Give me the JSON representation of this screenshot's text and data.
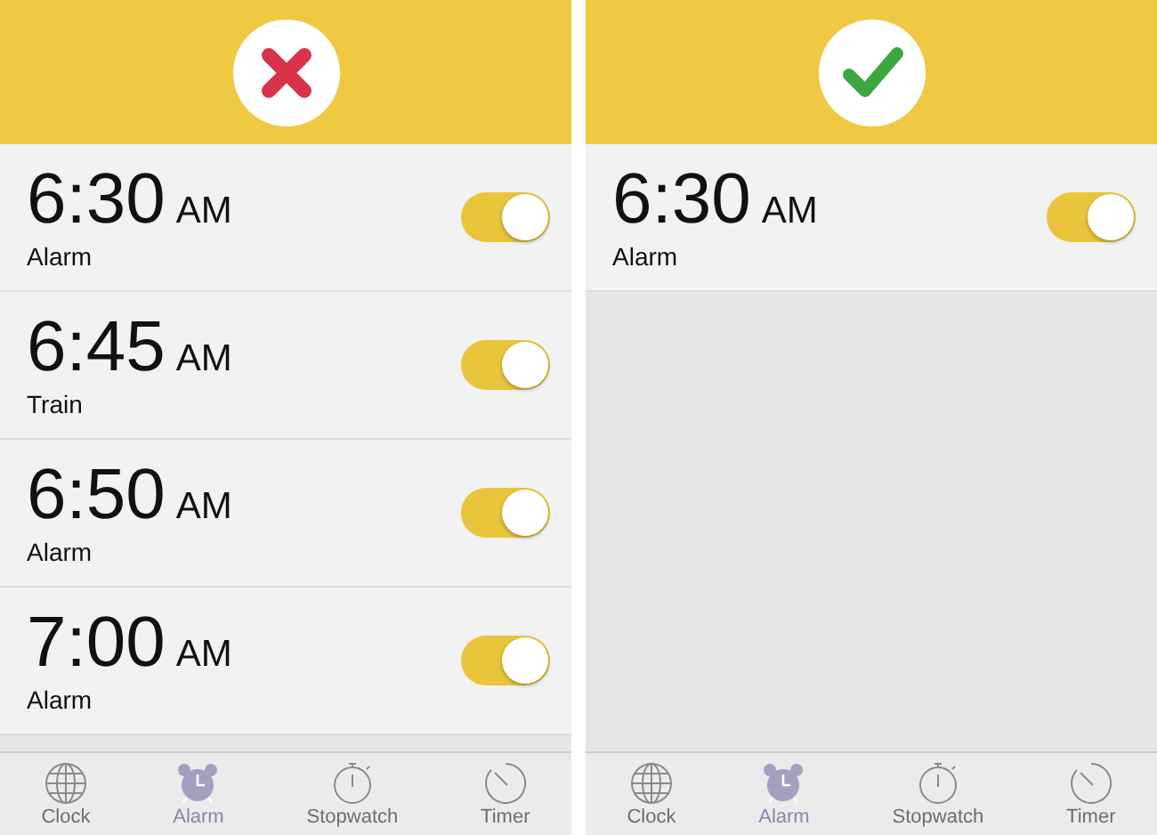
{
  "panels": [
    {
      "kind": "wrong",
      "alarms": [
        {
          "time": "6:30",
          "period": "AM",
          "label": "Alarm",
          "on": true
        },
        {
          "time": "6:45",
          "period": "AM",
          "label": "Train",
          "on": true
        },
        {
          "time": "6:50",
          "period": "AM",
          "label": "Alarm",
          "on": true
        },
        {
          "time": "7:00",
          "period": "AM",
          "label": "Alarm",
          "on": true
        }
      ],
      "tabs": [
        {
          "kind": "globe",
          "label": "Clock",
          "selected": false
        },
        {
          "kind": "alarm",
          "label": "Alarm",
          "selected": true
        },
        {
          "kind": "stopwatch",
          "label": "Stopwatch",
          "selected": false
        },
        {
          "kind": "timer",
          "label": "Timer",
          "selected": false
        }
      ]
    },
    {
      "kind": "right",
      "alarms": [
        {
          "time": "6:30",
          "period": "AM",
          "label": "Alarm",
          "on": true
        }
      ],
      "tabs": [
        {
          "kind": "globe",
          "label": "Clock",
          "selected": false
        },
        {
          "kind": "alarm",
          "label": "Alarm",
          "selected": true
        },
        {
          "kind": "stopwatch",
          "label": "Stopwatch",
          "selected": false
        },
        {
          "kind": "timer",
          "label": "Timer",
          "selected": false
        }
      ]
    }
  ]
}
